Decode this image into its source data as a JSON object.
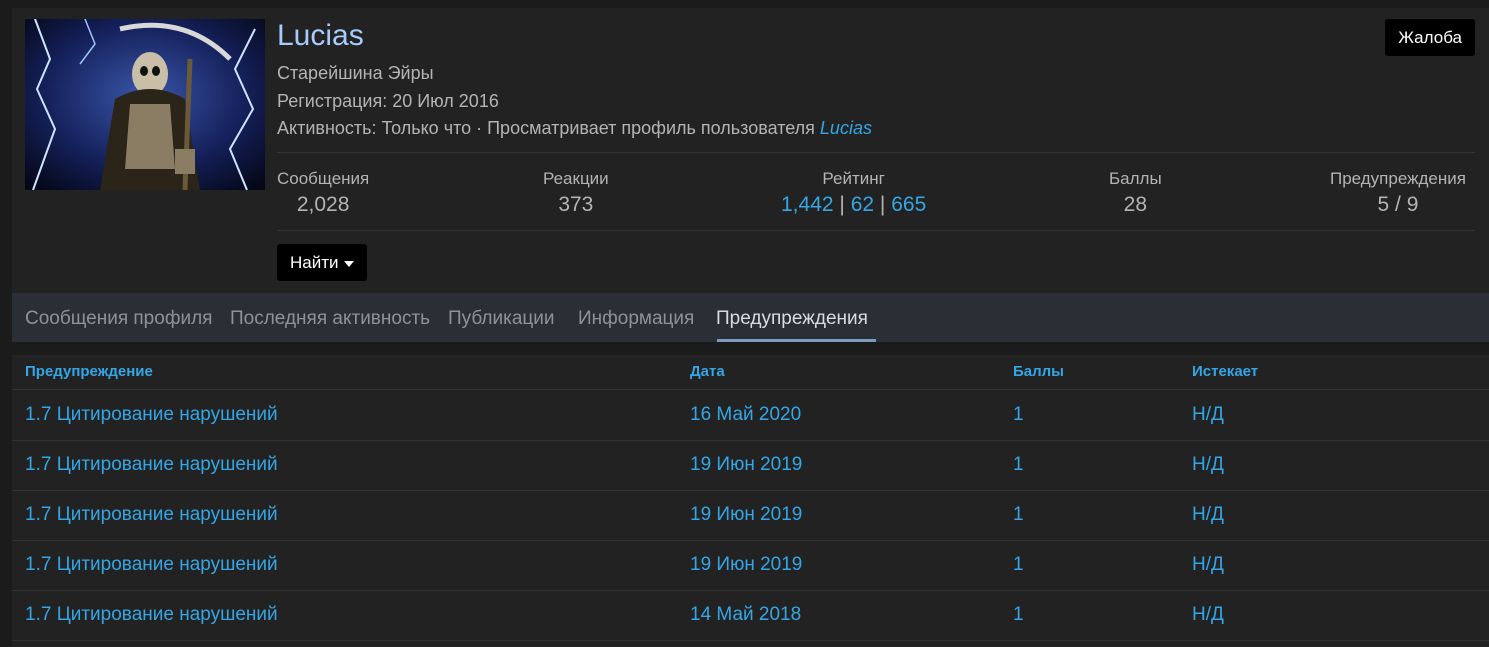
{
  "profile": {
    "username": "Lucias",
    "title": "Старейшина Эйры",
    "registration": "Регистрация: 20 Июл 2016",
    "activity_prefix": "Активность: Только что · Просматривает профиль пользователя ",
    "activity_link": "Lucias",
    "report_label": "Жалоба",
    "find_label": "Найти",
    "avatar_icon": "grim-reaper-avatar"
  },
  "stats": {
    "messages": {
      "label": "Сообщения",
      "value": "2,028"
    },
    "reactions": {
      "label": "Реакции",
      "value": "373"
    },
    "rating": {
      "label": "Рейтинг",
      "v1": "1,442",
      "sep1": "|",
      "v2": "62",
      "sep2": "|",
      "v3": "665"
    },
    "points": {
      "label": "Баллы",
      "value": "28"
    },
    "warnings": {
      "label": "Предупреждения",
      "value": "5 / 9"
    }
  },
  "tabs": [
    {
      "label": "Сообщения профиля"
    },
    {
      "label": "Последняя активность"
    },
    {
      "label": "Публикации"
    },
    {
      "label": "Информация"
    },
    {
      "label": "Предупреждения",
      "active": true
    }
  ],
  "table": {
    "headers": {
      "warning": "Предупреждение",
      "date": "Дата",
      "points": "Баллы",
      "expires": "Истекает"
    },
    "rows": [
      {
        "warning": "1.7 Цитирование нарушений",
        "date": "16 Май 2020",
        "points": "1",
        "expires": "Н/Д"
      },
      {
        "warning": "1.7 Цитирование нарушений",
        "date": "19 Июн 2019",
        "points": "1",
        "expires": "Н/Д"
      },
      {
        "warning": "1.7 Цитирование нарушений",
        "date": "19 Июн 2019",
        "points": "1",
        "expires": "Н/Д"
      },
      {
        "warning": "1.7 Цитирование нарушений",
        "date": "19 Июн 2019",
        "points": "1",
        "expires": "Н/Д"
      },
      {
        "warning": "1.7 Цитирование нарушений",
        "date": "14 Май 2018",
        "points": "1",
        "expires": "Н/Д"
      }
    ]
  },
  "colors": {
    "background": "#1b1b1b",
    "card": "#222222",
    "link_blue": "#34a6e6",
    "username": "#a6ccff",
    "button_bg": "#000000"
  }
}
